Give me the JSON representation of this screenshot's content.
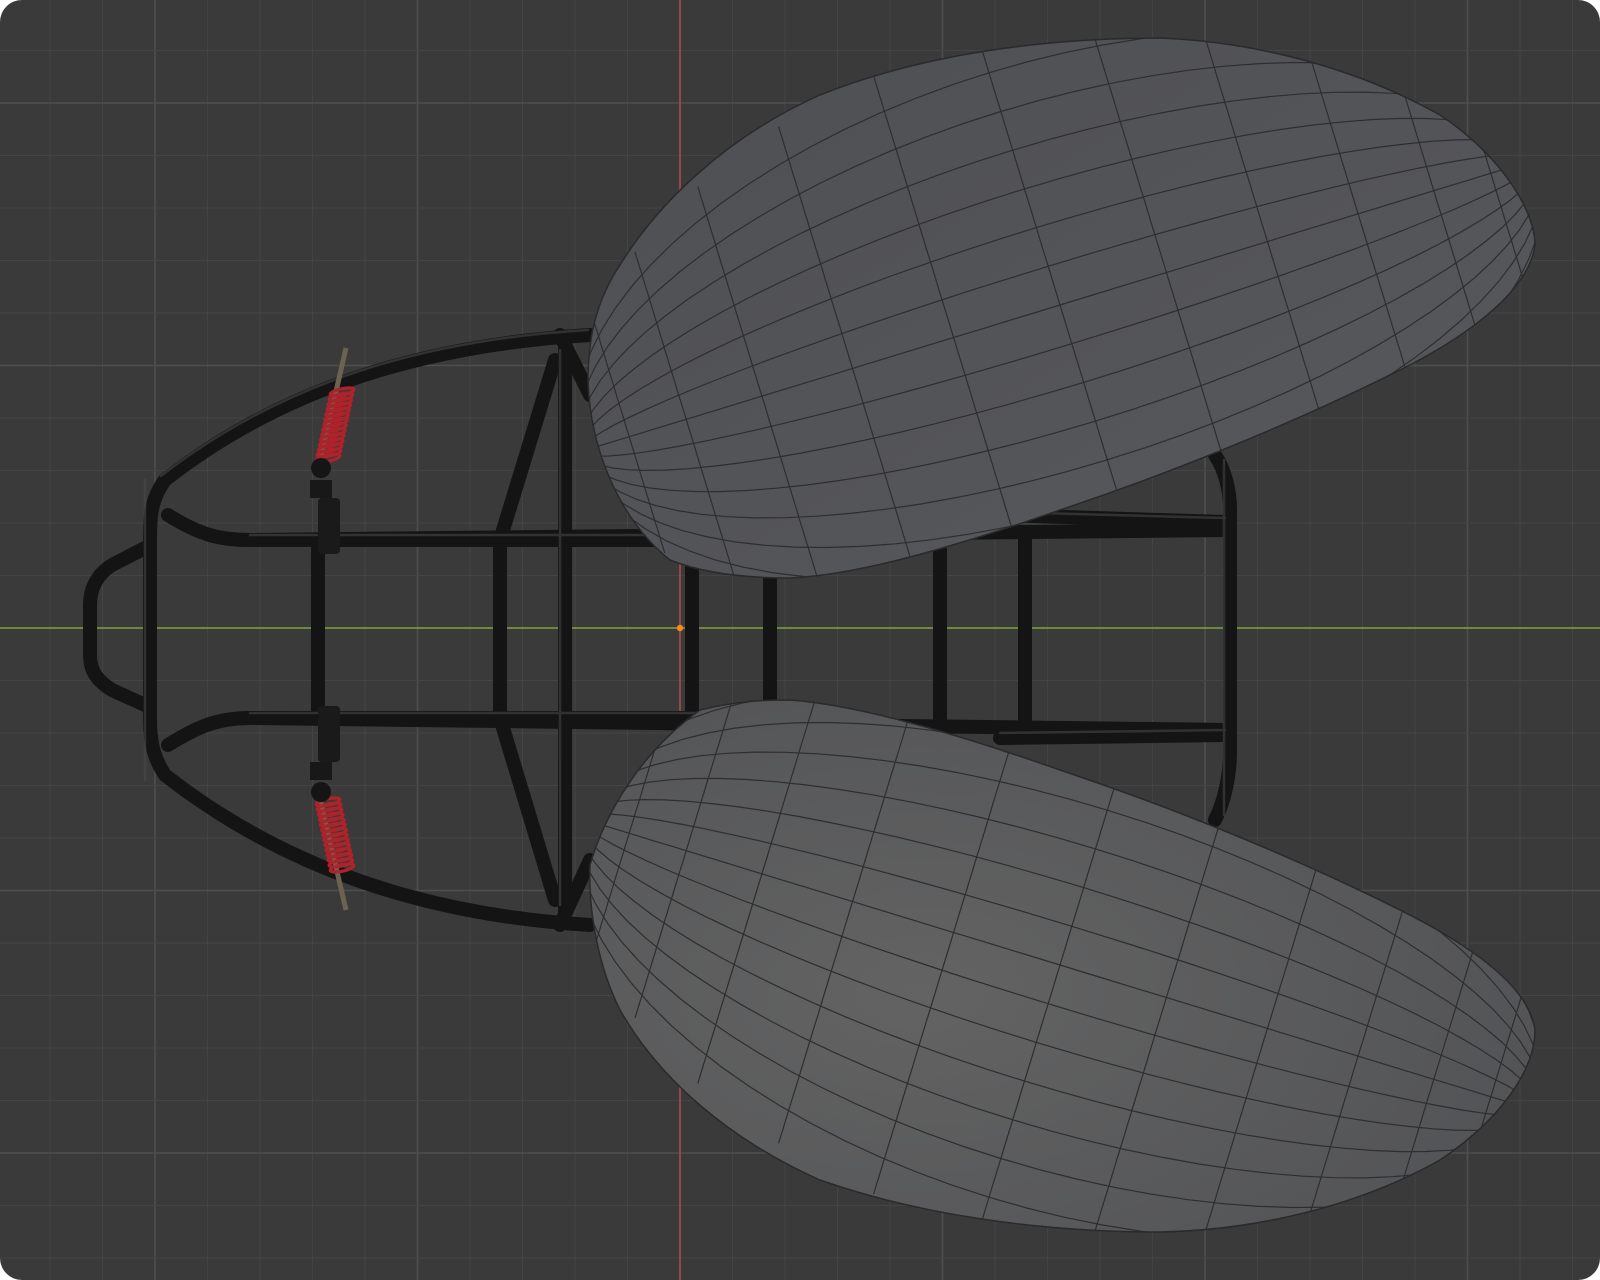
{
  "viewport": {
    "name": "3d-viewport",
    "view": "top-orthographic",
    "background_color": "#3a3a3a",
    "grid_minor_color": "#444444",
    "grid_major_color": "#4e4e4e",
    "axis_x_color": "#7aa23a",
    "axis_y_color": "#b0464e",
    "origin_color": "#f58a1c"
  },
  "scene": {
    "objects": [
      {
        "name": "tube-chassis-frame",
        "material_color": "#141414",
        "highlight_color": "#4a4a4a"
      },
      {
        "name": "shock-absorber-left",
        "spring_color": "#b0222a"
      },
      {
        "name": "shock-absorber-right",
        "spring_color": "#b0222a"
      },
      {
        "name": "body-shell-upper",
        "shade_color": "#55565a",
        "wire_color": "#2e2e30"
      },
      {
        "name": "body-shell-lower",
        "shade_color": "#58585a",
        "wire_color": "#2e2e30"
      }
    ]
  }
}
